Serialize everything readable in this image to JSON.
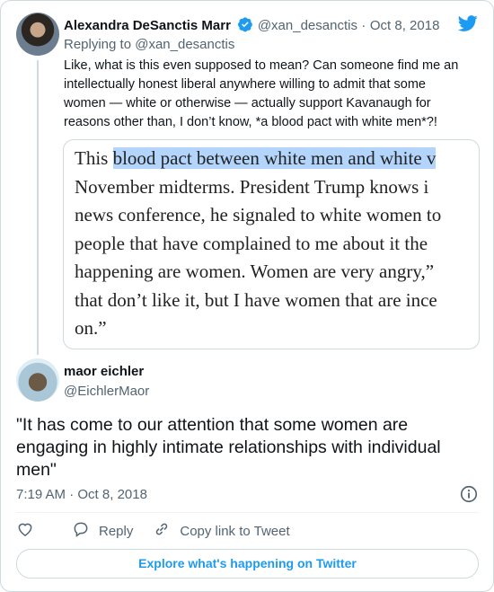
{
  "tweet1": {
    "author_name": "Alexandra DeSanctis Marr",
    "author_handle": "@xan_desanctis",
    "date": "Oct 8, 2018",
    "separator": "·",
    "replying_prefix": "Replying to",
    "replying_to": "@xan_desanctis",
    "text_lines": [
      "Like, what is this even supposed to mean? Can someone find me an",
      "intellectually honest liberal anywhere willing to admit that some",
      "women — white or otherwise — actually support Kavanaugh for",
      "reasons other than, I don’t know, *a blood pact with white men*?!"
    ],
    "quote_image_lines": [
      {
        "pre": "This ",
        "hl": "blood pact between white men and white v",
        "post": ""
      },
      {
        "pre": "November midterms. President Trump knows i",
        "hl": "",
        "post": ""
      },
      {
        "pre": "news conference, he signaled to white women to",
        "hl": "",
        "post": ""
      },
      {
        "pre": "people that have complained to me about it the",
        "hl": "",
        "post": ""
      },
      {
        "pre": "happening are women. Women are very angry,”",
        "hl": "",
        "post": ""
      },
      {
        "pre": "that don’t like it, but I have women that are ince",
        "hl": "",
        "post": ""
      },
      {
        "pre": "on.”",
        "hl": "",
        "post": ""
      }
    ]
  },
  "tweet2": {
    "author_name": "maor eichler",
    "author_handle": "@EichlerMaor",
    "text_lines": [
      "\"It has come to our attention that some women are",
      "engaging in highly intimate relationships with individual",
      "men\""
    ],
    "time": "7:19 AM",
    "separator": "·",
    "date": "Oct 8, 2018"
  },
  "actions": {
    "reply_label": "Reply",
    "copy_link_label": "Copy link to Tweet"
  },
  "explore_label": "Explore what's happening on Twitter",
  "colors": {
    "accent": "#1d9bf0",
    "muted": "#536471",
    "highlight": "#b3d4fb"
  }
}
